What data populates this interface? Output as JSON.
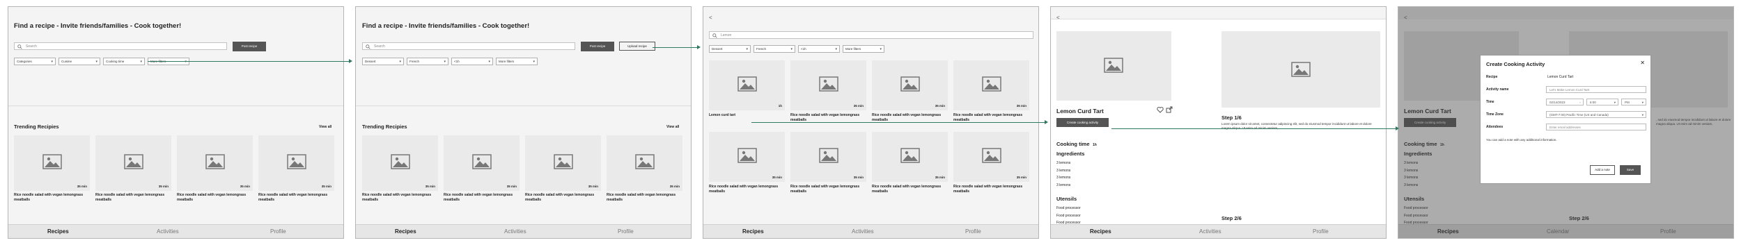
{
  "screen1": {
    "title": "Find a recipe - Invite friends/families - Cook together!",
    "search_placeholder": "Search",
    "post_btn": "Post recipe",
    "filters": [
      "Categories",
      "Cuisine",
      "Cooking time",
      "More filters"
    ],
    "trending": "Trending Recipies",
    "view_all": "View all",
    "cards": [
      {
        "time": "35 min",
        "caption": "Rice noodle salad with vegan lemongrass meatballs"
      },
      {
        "time": "35 min",
        "caption": "Rice noodle salad with vegan lemongrass meatballs"
      },
      {
        "time": "35 min",
        "caption": "Rice noodle salad with vegan lemongrass meatballs"
      },
      {
        "time": "35 min",
        "caption": "Rice noodle salad with vegan lemongrass meatballs"
      }
    ],
    "nav": [
      "Recipes",
      "Activities",
      "Profile"
    ]
  },
  "screen2": {
    "title": "Find a recipe - Invite friends/families - Cook together!",
    "search_placeholder": "Search",
    "post_btn": "Post recipe",
    "upload_btn": "Upload recipe",
    "filters": [
      "Dessert",
      "French",
      "<1h",
      "More filters"
    ],
    "trending": "Trending Recipies",
    "view_all": "View all",
    "cards": [
      {
        "time": "35 min",
        "caption": "Rice noodle salad with vegan lemongrass meatballs"
      },
      {
        "time": "35 min",
        "caption": "Rice noodle salad with vegan lemongrass meatballs"
      },
      {
        "time": "35 min",
        "caption": "Rice noodle salad with vegan lemongrass meatballs"
      },
      {
        "time": "35 min",
        "caption": "Rice noodle salad with vegan lemongrass meatballs"
      }
    ],
    "nav": [
      "Recipes",
      "Activities",
      "Profile"
    ]
  },
  "screen3": {
    "back": "<",
    "search_value": "Lemon",
    "filters": [
      "Dessert",
      "French",
      "<1h",
      "More filters"
    ],
    "grid": [
      {
        "time": "1h",
        "caption": "Lemon curd tart"
      },
      {
        "time": "35 min",
        "caption": "Rice noodle salad with vegan lemongrass meatballs"
      },
      {
        "time": "35 min",
        "caption": "Rice noodle salad with vegan lemongrass meatballs"
      },
      {
        "time": "35 min",
        "caption": "Rice noodle salad with vegan lemongrass meatballs"
      },
      {
        "time": "35 min",
        "caption": "Rice noodle salad with vegan lemongrass meatballs"
      },
      {
        "time": "35 min",
        "caption": "Rice noodle salad with vegan lemongrass meatballs"
      },
      {
        "time": "35 min",
        "caption": "Rice noodle salad with vegan lemongrass meatballs"
      },
      {
        "time": "35 min",
        "caption": "Rice noodle salad with vegan lemongrass meatballs"
      }
    ],
    "nav": [
      "Recipes",
      "Activities",
      "Profile"
    ]
  },
  "screen4": {
    "back": "<",
    "recipe_title": "Lemon Curd Tart",
    "create_btn": "Create cooking activity",
    "cooking_time_label": "Cooking time",
    "cooking_time_value": "1h",
    "ingredients_label": "Ingredients",
    "ingredients": [
      "3 lemons",
      "3 lemons",
      "3 lemons",
      "3 lemons"
    ],
    "utensils_label": "Utensils",
    "utensils": [
      "Food processor",
      "Food processor",
      "Food processor"
    ],
    "step1": "Step 1/6",
    "step1_text": "Lorem ipsum dolor sit amet, consectetur adipiscing elit, sed do eiusmod tempor incididunt ut labore et dolore magna aliqua. Ut enim ad minim veniam,",
    "step2": "Step 2/6",
    "nav": [
      "Recipes",
      "Activities",
      "Profile"
    ]
  },
  "screen5": {
    "back": "<",
    "recipe_title": "Lemon Curd Tart",
    "create_btn": "Create cooking activity",
    "cooking_time_label": "Cooking time",
    "cooking_time_value": "1h",
    "ingredients_label": "Ingredients",
    "ingredients": [
      "3 lemons",
      "3 lemons",
      "3 lemons",
      "3 lemons"
    ],
    "utensils_label": "Utensils",
    "utensils": [
      "Food processor",
      "Food processor",
      "Food processor"
    ],
    "step_partial": ", sed do eiusmod tempor incididunt ut labore et dolore magna aliqua. Ut enim ad minim veniam,",
    "step2": "Step 2/6",
    "nav": [
      "Recipes",
      "Calendar",
      "Profile"
    ],
    "modal": {
      "title": "Create Cooking Activity",
      "close": "✕",
      "recipe_label": "Recipe",
      "recipe_value": "Lemon Curd Tart",
      "activity_label": "Activity name",
      "activity_placeholder": "Let's Make Lemon Curd Tart!",
      "time_label": "Time",
      "date_value": "02/14/2023",
      "time_value": "6:00",
      "ampm": "PM",
      "tz_label": "Time Zone",
      "tz_value": "(GMT-7:00) Pacific Time (US and Canada)",
      "attendees_label": "Attendees",
      "attendees_placeholder": "Enter email addresses",
      "note": "You can add a note with any additional information.",
      "add_note_btn": "Add a note",
      "save_btn": "Save"
    }
  }
}
